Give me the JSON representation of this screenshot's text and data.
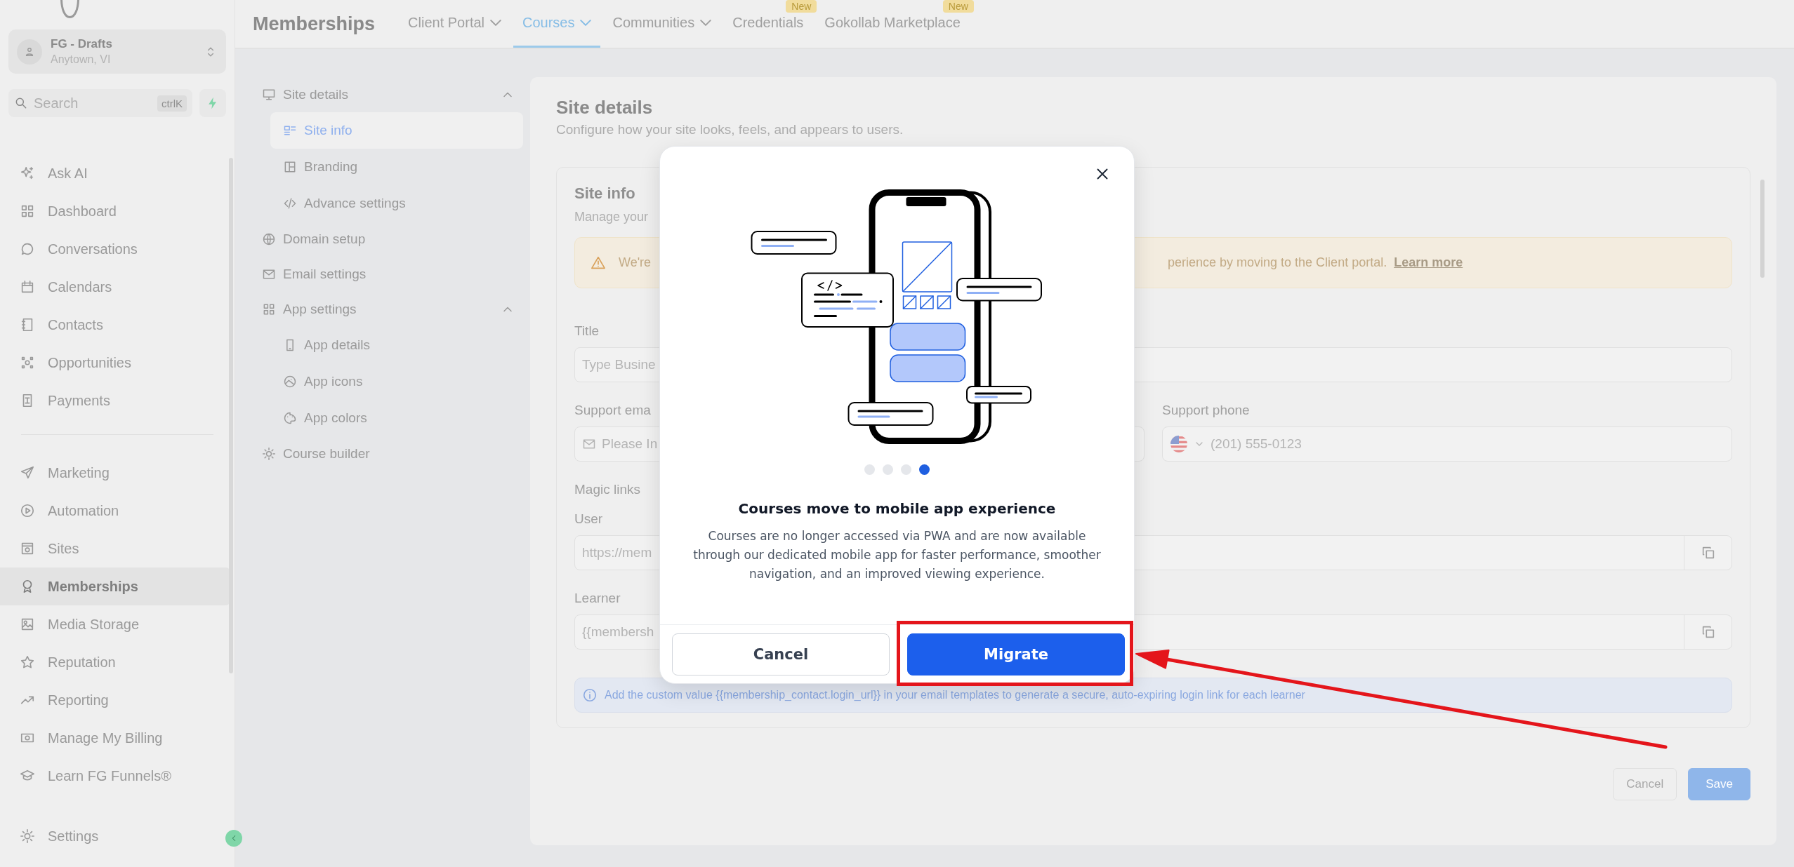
{
  "sidebar": {
    "account": {
      "name": "FG - Drafts",
      "location": "Anytown, VI"
    },
    "search": {
      "placeholder": "Search",
      "shortcut": "ctrlK"
    },
    "groups": [
      {
        "items": [
          {
            "label": "Ask AI",
            "selected": false
          },
          {
            "label": "Dashboard",
            "selected": false
          },
          {
            "label": "Conversations",
            "selected": false
          },
          {
            "label": "Calendars",
            "selected": false
          },
          {
            "label": "Contacts",
            "selected": false
          },
          {
            "label": "Opportunities",
            "selected": false
          },
          {
            "label": "Payments",
            "selected": false
          }
        ]
      },
      {
        "items": [
          {
            "label": "Marketing",
            "selected": false
          },
          {
            "label": "Automation",
            "selected": false
          },
          {
            "label": "Sites",
            "selected": false
          },
          {
            "label": "Memberships",
            "selected": true
          },
          {
            "label": "Media Storage",
            "selected": false
          },
          {
            "label": "Reputation",
            "selected": false
          },
          {
            "label": "Reporting",
            "selected": false
          },
          {
            "label": "Manage My Billing",
            "selected": false
          },
          {
            "label": "Learn FG Funnels®",
            "selected": false
          }
        ]
      }
    ],
    "settings": {
      "label": "Settings",
      "selected": false
    }
  },
  "header": {
    "title": "Memberships",
    "tabs": [
      {
        "label": "Client Portal",
        "selected": false,
        "dropdown": true
      },
      {
        "label": "Courses",
        "selected": true,
        "dropdown": true
      },
      {
        "label": "Communities",
        "selected": false,
        "dropdown": true
      },
      {
        "label": "Credentials",
        "selected": false,
        "dropdown": false,
        "badge": "New"
      },
      {
        "label": "Gokollab Marketplace",
        "selected": false,
        "dropdown": false,
        "badge": "New"
      }
    ]
  },
  "settings_nav": [
    {
      "kind": "group",
      "label": "Site details",
      "selected": false,
      "expanded": true,
      "children": [
        {
          "label": "Site info",
          "selected": true
        },
        {
          "label": "Branding",
          "selected": false
        },
        {
          "label": "Advance settings",
          "selected": false
        }
      ]
    },
    {
      "kind": "link",
      "label": "Domain setup",
      "selected": false
    },
    {
      "kind": "link",
      "label": "Email settings",
      "selected": false
    },
    {
      "kind": "group",
      "label": "App settings",
      "selected": false,
      "expanded": true,
      "children": [
        {
          "label": "App details",
          "selected": false
        },
        {
          "label": "App icons",
          "selected": false
        },
        {
          "label": "App colors",
          "selected": false
        }
      ]
    },
    {
      "kind": "link",
      "label": "Course builder",
      "selected": false
    }
  ],
  "page": {
    "title": "Site details",
    "subtitle": "Configure how your site looks, feels, and appears to users.",
    "section": {
      "title": "Site info",
      "description": "Manage your",
      "warning": {
        "lead": "We're",
        "tail": "perience by moving to the Client portal.",
        "link": "Learn more"
      },
      "title_field": {
        "label": "Title",
        "placeholder": "Type Busine"
      },
      "email_field": {
        "label": "Support ema",
        "placeholder": "Please In"
      },
      "phone_field": {
        "label": "Support phone",
        "placeholder": "(201) 555-0123"
      },
      "magic_links": {
        "label": "Magic links",
        "user": {
          "label": "User",
          "value": "https://mem"
        },
        "learner": {
          "label": "Learner",
          "value": "{{membersh"
        }
      },
      "info": "Add the custom value {{membership_contact.login_url}} in your email templates to generate a secure, auto-expiring login link for each learner"
    },
    "buttons": {
      "cancel": "Cancel",
      "save": "Save"
    }
  },
  "modal": {
    "title": "Courses move to mobile app experience",
    "body": "Courses are no longer accessed via PWA and are now available through our dedicated mobile app for faster performance, smoother navigation, and an improved viewing experience.",
    "steps": [
      {
        "selected": false
      },
      {
        "selected": false
      },
      {
        "selected": false
      },
      {
        "selected": true
      }
    ],
    "cancel": "Cancel",
    "confirm": "Migrate"
  }
}
